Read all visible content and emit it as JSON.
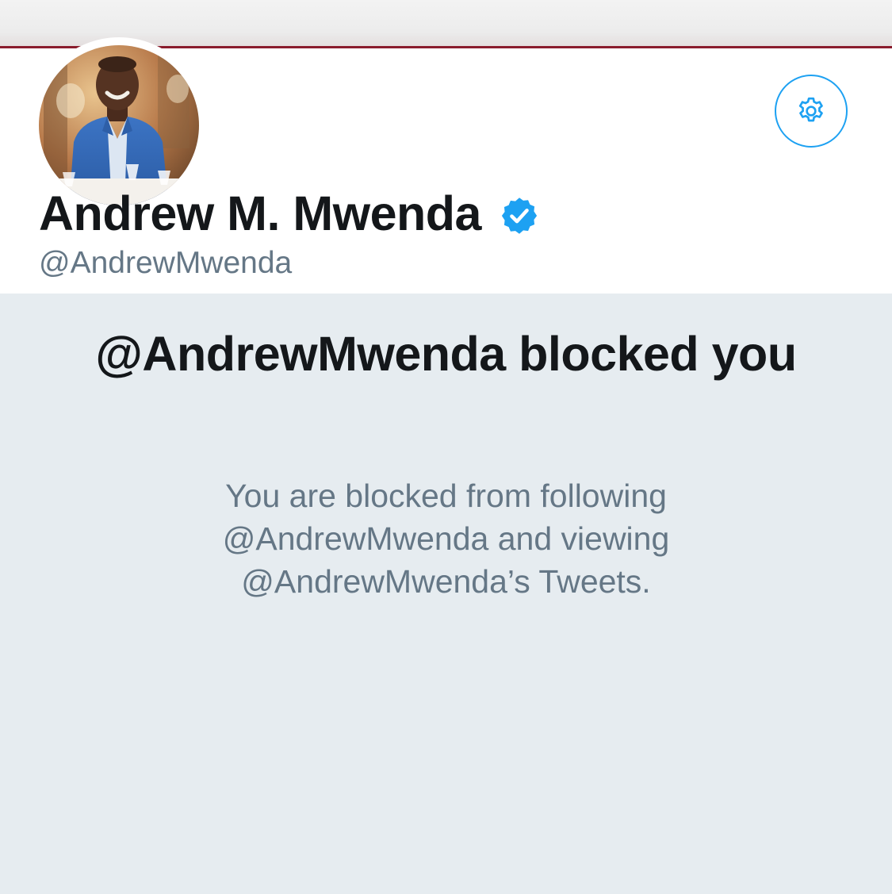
{
  "profile": {
    "display_name": "Andrew M. Mwenda",
    "handle": "@AndrewMwenda",
    "verified": true,
    "avatar_icon": "profile-photo",
    "settings_icon": "gear-icon",
    "verified_icon": "verified-badge-icon"
  },
  "blocked": {
    "title": "@AndrewMwenda blocked you",
    "message": "You are blocked from following @AndrewMwenda and viewing @AndrewMwenda’s Tweets."
  },
  "colors": {
    "accent": "#1da1f2",
    "banner_line": "#8a1b2c",
    "panel_background": "#e6ecf0",
    "primary_text": "#14171a",
    "secondary_text": "#657786"
  }
}
